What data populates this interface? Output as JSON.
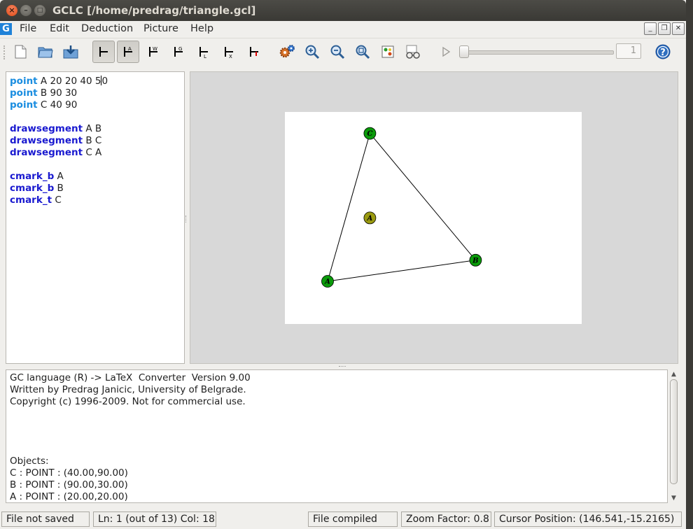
{
  "window": {
    "title": "GCLC [/home/predrag/triangle.gcl]"
  },
  "menu": [
    "File",
    "Edit",
    "Deduction",
    "Picture",
    "Help"
  ],
  "toolbar": {
    "step_value": "1"
  },
  "editor": {
    "lines": [
      {
        "kw": "point",
        "rest": " A 20 20 40 5",
        "tail": "0"
      },
      {
        "kw": "point",
        "rest": " B 90 30"
      },
      {
        "kw": "point",
        "rest": " C 40 90"
      },
      {
        "kw": "",
        "rest": ""
      },
      {
        "kw": "drawsegment",
        "rest": " A B"
      },
      {
        "kw": "drawsegment",
        "rest": " B C"
      },
      {
        "kw": "drawsegment",
        "rest": " C A"
      },
      {
        "kw": "",
        "rest": ""
      },
      {
        "kw": "cmark_b",
        "rest": " A"
      },
      {
        "kw": "cmark_b",
        "rest": " B"
      },
      {
        "kw": "cmark_t",
        "rest": " C"
      }
    ]
  },
  "picture": {
    "points": [
      {
        "label": "A",
        "x": 20,
        "y": 20,
        "color": "#0a9a0a"
      },
      {
        "label": "B",
        "x": 90,
        "y": 30,
        "color": "#0a9a0a"
      },
      {
        "label": "C",
        "x": 40,
        "y": 90,
        "color": "#0a9a0a"
      },
      {
        "label": "A",
        "x": 40,
        "y": 50,
        "color": "#9a9a10"
      }
    ],
    "segments": [
      [
        "A",
        "B"
      ],
      [
        "B",
        "C"
      ],
      [
        "C",
        "A"
      ]
    ]
  },
  "console": {
    "lines": [
      "GC language (R) -> LaTeX  Converter  Version 9.00",
      "Written by Predrag Janicic, University of Belgrade.",
      "Copyright (c) 1996-2009. Not for commercial use.",
      "",
      "",
      "",
      "",
      "Objects:",
      "C : POINT : (40.00,90.00)",
      "B : POINT : (90.00,30.00)",
      "A : POINT : (20.00,20.00)"
    ]
  },
  "status": {
    "saved": "File not saved",
    "position": "Ln: 1 (out of 13) Col: 18",
    "compiled": "File compiled",
    "zoom": "Zoom Factor: 0.8",
    "cursor": "Cursor Position: (146.541,-15.2165)"
  },
  "colors": {
    "keyword_point": "#1a8de0",
    "keyword_command": "#1a1ad0",
    "point_fill": "#0a9a0a",
    "center_fill": "#9a9a10"
  }
}
